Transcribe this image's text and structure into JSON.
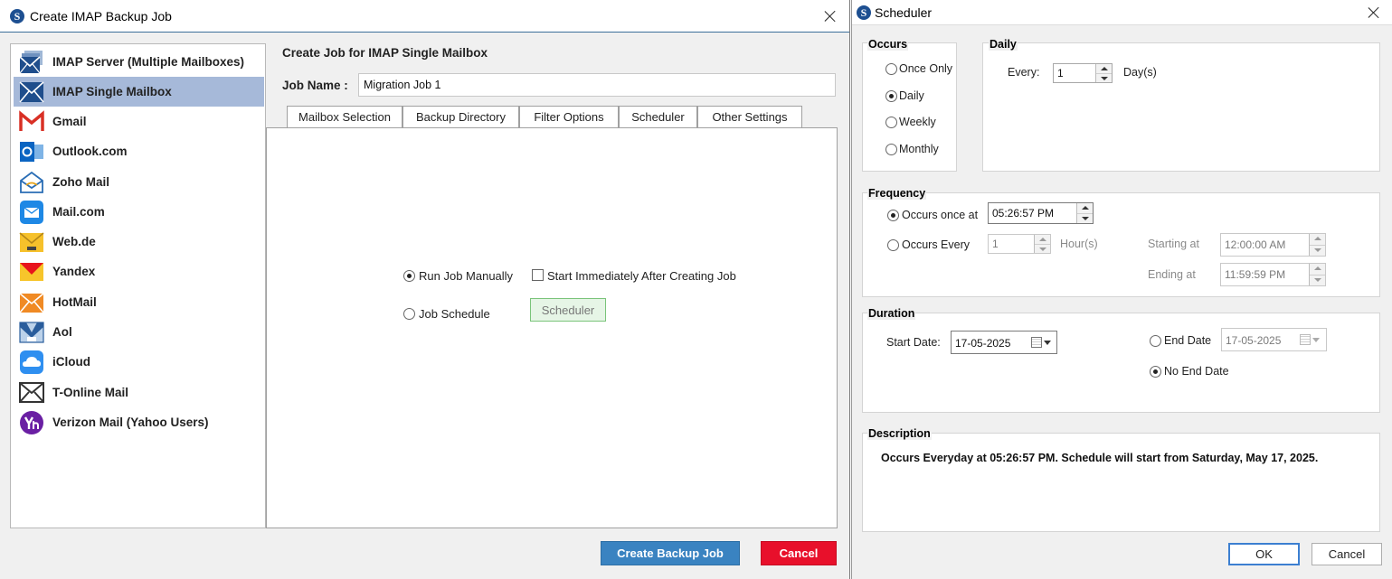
{
  "left_window": {
    "title": "Create IMAP Backup Job",
    "app_logo_letter": "S",
    "sidebar": {
      "items": [
        {
          "label": "IMAP Server (Multiple Mailboxes)",
          "icon": "imap-server-icon",
          "selected": false
        },
        {
          "label": "IMAP Single Mailbox",
          "icon": "imap-mailbox-icon",
          "selected": true
        },
        {
          "label": "Gmail",
          "icon": "gmail-icon",
          "selected": false
        },
        {
          "label": "Outlook.com",
          "icon": "outlook-icon",
          "selected": false
        },
        {
          "label": "Zoho Mail",
          "icon": "zoho-mail-icon",
          "selected": false
        },
        {
          "label": "Mail.com",
          "icon": "mail-com-icon",
          "selected": false
        },
        {
          "label": "Web.de",
          "icon": "web-de-icon",
          "selected": false
        },
        {
          "label": "Yandex",
          "icon": "yandex-icon",
          "selected": false
        },
        {
          "label": "HotMail",
          "icon": "hotmail-icon",
          "selected": false
        },
        {
          "label": "Aol",
          "icon": "aol-icon",
          "selected": false
        },
        {
          "label": "iCloud",
          "icon": "icloud-icon",
          "selected": false
        },
        {
          "label": "T-Online Mail",
          "icon": "t-online-icon",
          "selected": false
        },
        {
          "label": "Verizon Mail (Yahoo Users)",
          "icon": "verizon-yahoo-icon",
          "selected": false
        }
      ]
    },
    "panel": {
      "heading": "Create Job for IMAP Single Mailbox",
      "job_name_label": "Job Name :",
      "job_name_value": "Migration Job 1",
      "tabs": [
        "Mailbox Selection",
        "Backup Directory",
        "Filter Options",
        "Scheduler",
        "Other Settings"
      ],
      "active_tab": "Scheduler",
      "run_manually_label": "Run Job Manually",
      "run_manually_selected": true,
      "start_immediately_label": "Start Immediately After Creating Job",
      "start_immediately_checked": false,
      "job_schedule_label": "Job Schedule",
      "job_schedule_selected": false,
      "scheduler_button": "Scheduler"
    },
    "footer": {
      "create_label": "Create Backup Job",
      "cancel_label": "Cancel"
    },
    "colors": {
      "selected_item": "#a6b9d9",
      "create_button": "#3a83c1",
      "cancel_button": "#e8102b",
      "scheduler_button_bg": "#e6f5e6"
    }
  },
  "right_window": {
    "title": "Scheduler",
    "app_logo_letter": "S",
    "occurs": {
      "title": "Occurs",
      "options": [
        {
          "label": "Once Only",
          "selected": false
        },
        {
          "label": "Daily",
          "selected": true
        },
        {
          "label": "Weekly",
          "selected": false
        },
        {
          "label": "Monthly",
          "selected": false
        }
      ]
    },
    "daily": {
      "title": "Daily",
      "every_label": "Every:",
      "every_value": "1",
      "unit_label": "Day(s)"
    },
    "frequency": {
      "title": "Frequency",
      "once_at_label": "Occurs once at",
      "once_at_value": "05:26:57 PM",
      "once_at_selected": true,
      "every_label": "Occurs Every",
      "every_value": "1",
      "every_unit": "Hour(s)",
      "starting_label": "Starting at",
      "starting_value": "12:00:00 AM",
      "ending_label": "Ending at",
      "ending_value": "11:59:59 PM"
    },
    "duration": {
      "title": "Duration",
      "start_label": "Start Date:",
      "start_value": "17-05-2025",
      "end_date_label": "End Date",
      "end_date_value": "17-05-2025",
      "end_date_selected": false,
      "no_end_label": "No End Date",
      "no_end_selected": true
    },
    "description": {
      "title": "Description",
      "text": "Occurs Everyday at 05:26:57 PM. Schedule will start from Saturday, May 17, 2025."
    },
    "ok_label": "OK",
    "cancel_label": "Cancel"
  }
}
